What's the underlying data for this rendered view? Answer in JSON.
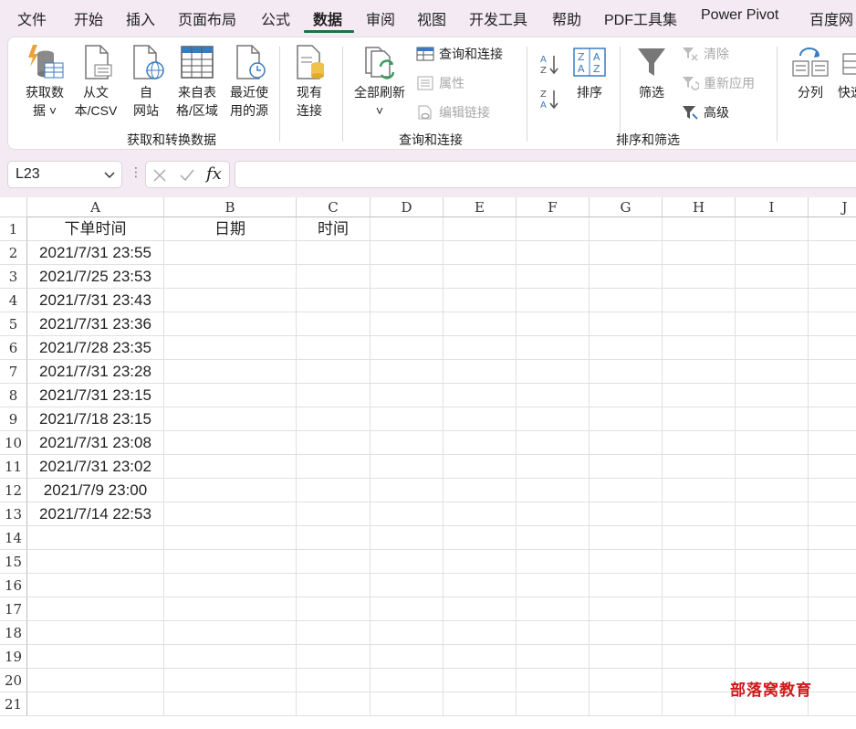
{
  "ribbon_tabs": [
    "文件",
    "开始",
    "插入",
    "页面布局",
    "公式",
    "数据",
    "审阅",
    "视图",
    "开发工具",
    "帮助",
    "PDF工具集",
    "Power Pivot",
    "百度网"
  ],
  "active_tab": "数据",
  "ribbon": {
    "get_data": {
      "line1": "获取数",
      "line2": "据 ˅"
    },
    "from_text": {
      "line1": "从文",
      "line2": "本/CSV"
    },
    "from_web": {
      "line1": "自",
      "line2": "网站"
    },
    "from_table": {
      "line1": "来自表",
      "line2": "格/区域"
    },
    "recent_sources": {
      "line1": "最近使",
      "line2": "用的源"
    },
    "existing_conn": {
      "line1": "现有",
      "line2": "连接"
    },
    "refresh_all": {
      "line1": "全部刷新",
      "line2": "˅"
    },
    "queries_conn": "查询和连接",
    "properties": "属性",
    "edit_links": "编辑链接",
    "sort": "排序",
    "filter": "筛选",
    "clear": "清除",
    "reapply": "重新应用",
    "advanced": "高级",
    "text_to_columns": "分列",
    "flash_fill": "快速",
    "groups": {
      "get_transform": "获取和转换数据",
      "queries": "查询和连接",
      "sort_filter": "排序和筛选"
    }
  },
  "formula_bar": {
    "name_box": "L23",
    "formula": ""
  },
  "sheet": {
    "columns": [
      "A",
      "B",
      "C",
      "D",
      "E",
      "F",
      "G",
      "H",
      "I",
      "J"
    ],
    "rows": [
      "1",
      "2",
      "3",
      "4",
      "5",
      "6",
      "7",
      "8",
      "9",
      "10",
      "11",
      "12",
      "13",
      "14",
      "15",
      "16",
      "17",
      "18",
      "19",
      "20",
      "21"
    ],
    "header_row": [
      "下单时间",
      "日期",
      "时间"
    ],
    "col_a": [
      "2021/7/31 23:55",
      "2021/7/25 23:53",
      "2021/7/31 23:43",
      "2021/7/31 23:36",
      "2021/7/28 23:35",
      "2021/7/31 23:28",
      "2021/7/31 23:15",
      "2021/7/18 23:15",
      "2021/7/31 23:08",
      "2021/7/31 23:02",
      "2021/7/9 23:00",
      "2021/7/14 22:53"
    ]
  },
  "watermark": "部落窝教育",
  "colors": {
    "accent": "#1e7145",
    "watermark": "#d01a1a"
  }
}
